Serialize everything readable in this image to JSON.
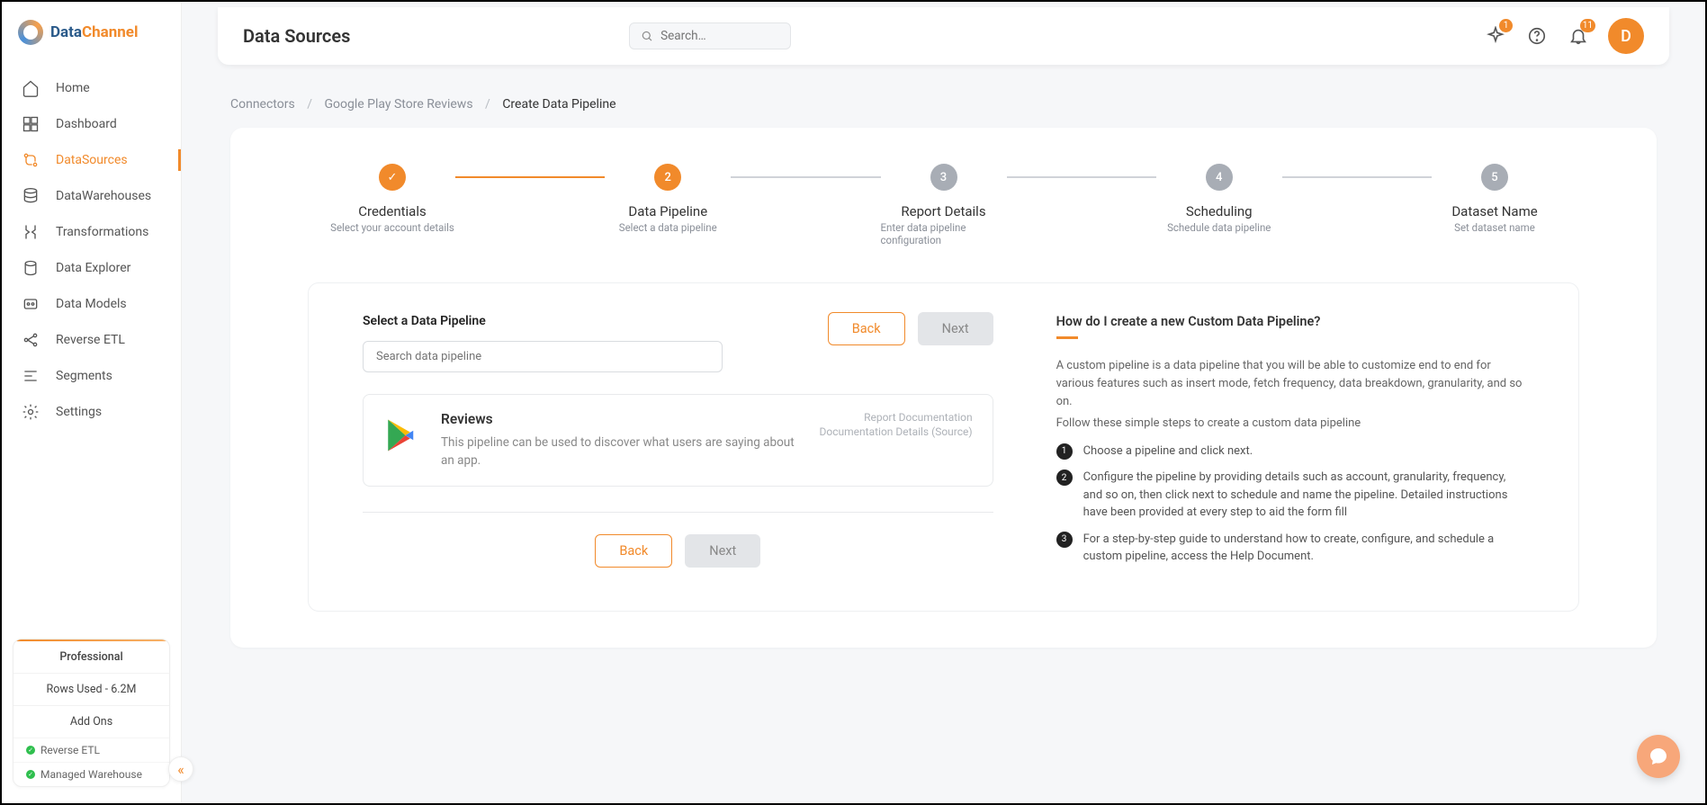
{
  "brand": {
    "name1": "Data",
    "name2": "Channel"
  },
  "nav": {
    "items": [
      {
        "label": "Home"
      },
      {
        "label": "Dashboard"
      },
      {
        "label": "DataSources"
      },
      {
        "label": "DataWarehouses"
      },
      {
        "label": "Transformations"
      },
      {
        "label": "Data Explorer"
      },
      {
        "label": "Data Models"
      },
      {
        "label": "Reverse ETL"
      },
      {
        "label": "Segments"
      },
      {
        "label": "Settings"
      }
    ]
  },
  "plan": {
    "tier": "Professional",
    "rows": "Rows Used - 6.2M",
    "addons_label": "Add Ons",
    "addons": [
      {
        "label": "Reverse ETL"
      },
      {
        "label": "Managed Warehouse"
      }
    ]
  },
  "header": {
    "title": "Data Sources",
    "search_placeholder": "Search…",
    "sparkle_badge": "1",
    "bell_badge": "11",
    "avatar_initial": "D"
  },
  "breadcrumb": {
    "items": [
      "Connectors",
      "Google Play Store Reviews"
    ],
    "current": "Create Data Pipeline"
  },
  "stepper": [
    {
      "title": "Credentials",
      "sub": "Select your account details",
      "state": "done",
      "num": "✓"
    },
    {
      "title": "Data Pipeline",
      "sub": "Select a data pipeline",
      "state": "active",
      "num": "2"
    },
    {
      "title": "Report Details",
      "sub": "Enter data pipeline configuration",
      "state": "pending",
      "num": "3"
    },
    {
      "title": "Scheduling",
      "sub": "Schedule data pipeline",
      "state": "pending",
      "num": "4"
    },
    {
      "title": "Dataset Name",
      "sub": "Set dataset name",
      "state": "pending",
      "num": "5"
    }
  ],
  "pipeline_section": {
    "label": "Select a Data Pipeline",
    "search_placeholder": "Search data pipeline",
    "card": {
      "title": "Reviews",
      "desc": "This pipeline can be used to discover what users are saying about an app.",
      "link1": "Report Documentation",
      "link2": "Documentation Details (Source)"
    }
  },
  "buttons": {
    "back": "Back",
    "next": "Next"
  },
  "help": {
    "title": "How do I create a new Custom Data Pipeline?",
    "p1": "A custom pipeline is a data pipeline that you will be able to customize end to end for various features such as insert mode, fetch frequency, data breakdown, granularity, and so on.",
    "p2": "Follow these simple steps to create a custom data pipeline",
    "steps": [
      "Choose a pipeline and click next.",
      "Configure the pipeline by providing details such as account, granularity, frequency, and so on, then click next to schedule and name the pipeline. Detailed instructions have been provided at every step to aid the form fill",
      "For a step-by-step guide to understand how to create, configure, and schedule a custom pipeline, access the Help Document."
    ]
  }
}
